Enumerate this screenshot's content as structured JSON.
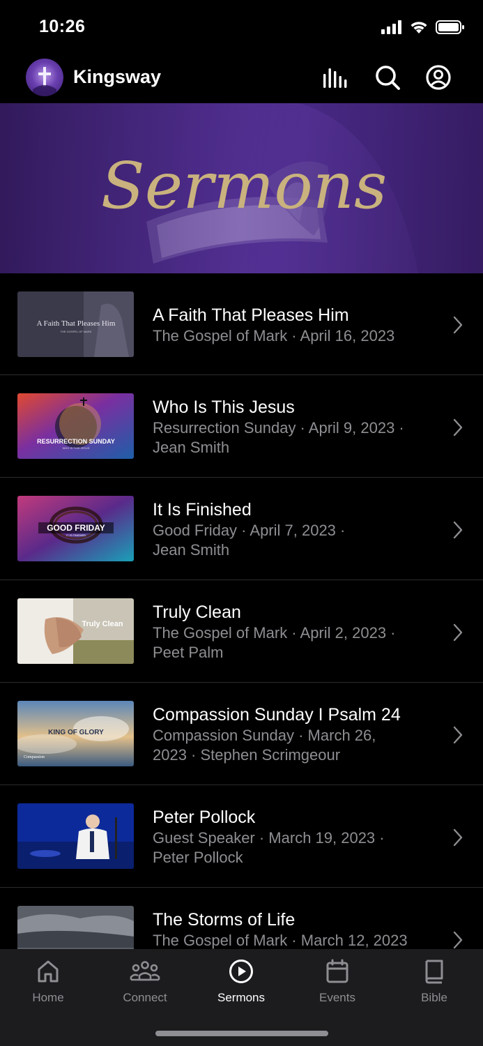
{
  "status": {
    "time": "10:26"
  },
  "header": {
    "church_name": "Kingsway"
  },
  "hero": {
    "title": "Sermons"
  },
  "sermons": [
    {
      "title": "A Faith That Pleases Him",
      "line1": "The Gospel of Mark · April 16, 2023",
      "line2": "",
      "thumb_text": "A Faith That Pleases Him",
      "thumb_sub": "THE GOSPEL OF MARK"
    },
    {
      "title": "Who Is This Jesus",
      "line1": "Resurrection Sunday · April 9, 2023 ·",
      "line2": "Jean Smith",
      "thumb_text": "RESURRECTION SUNDAY",
      "thumb_sub": "WHO IS THIS JESUS"
    },
    {
      "title": "It Is Finished",
      "line1": "Good Friday · April 7, 2023 ·",
      "line2": "Jean Smith",
      "thumb_text": "GOOD FRIDAY",
      "thumb_sub": "IT IS FINISHED"
    },
    {
      "title": "Truly Clean",
      "line1": "The Gospel of Mark · April 2, 2023 ·",
      "line2": "Peet Palm",
      "thumb_text": "Truly Clean"
    },
    {
      "title": "Compassion Sunday I Psalm 24",
      "line1": "Compassion Sunday · March 26,",
      "line2": "2023 · Stephen Scrimgeour",
      "thumb_text": "KING OF GLORY",
      "thumb_sub": "Compassion"
    },
    {
      "title": "Peter Pollock",
      "line1": "Guest Speaker · March 19, 2023 ·",
      "line2": "Peter Pollock"
    },
    {
      "title": "The Storms of Life",
      "line1": "The Gospel of Mark · March 12, 2023",
      "line2": ""
    }
  ],
  "tabs": [
    {
      "label": "Home",
      "icon": "home-icon"
    },
    {
      "label": "Connect",
      "icon": "people-icon"
    },
    {
      "label": "Sermons",
      "icon": "play-circle-icon"
    },
    {
      "label": "Events",
      "icon": "calendar-icon"
    },
    {
      "label": "Bible",
      "icon": "book-icon"
    }
  ],
  "colors": {
    "background": "#000000",
    "hero_purple": "#4a2a85",
    "script_gold": "#c9b27d",
    "secondary_text": "#8e8e93",
    "tab_bar": "#1c1c1e"
  }
}
